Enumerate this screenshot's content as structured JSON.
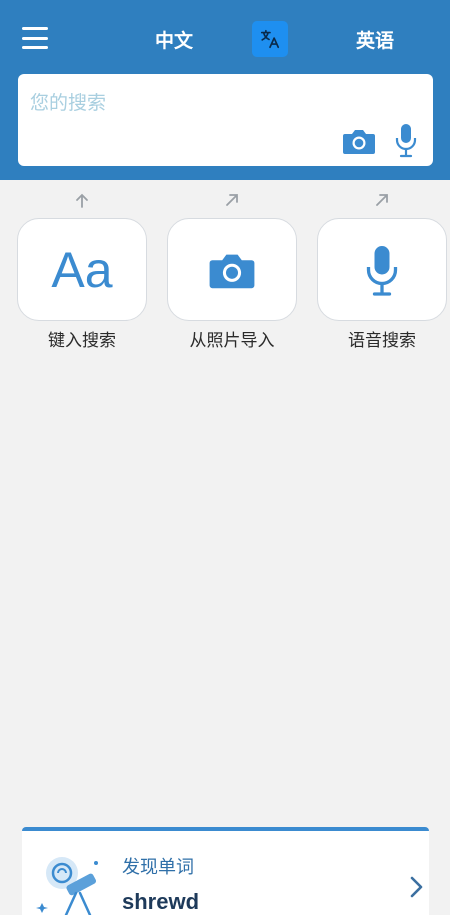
{
  "header": {
    "source_language": "中文",
    "target_language": "英语",
    "menu_icon": "hamburger-menu-icon",
    "swap_icon": "translate-icon"
  },
  "search": {
    "placeholder": "您的搜索",
    "value": "",
    "camera_icon": "camera-icon",
    "mic_icon": "microphone-icon"
  },
  "actions": [
    {
      "label": "键入搜索",
      "glyph": "Aa",
      "icon": "keyboard-text-icon"
    },
    {
      "label": "从照片导入",
      "icon": "camera-icon"
    },
    {
      "label": "语音搜索",
      "icon": "microphone-icon"
    }
  ],
  "discover": {
    "title": "发现单词",
    "word": "shrewd",
    "icon": "telescope-icon"
  },
  "colors": {
    "header_bg": "#2f7fbf",
    "accent": "#3b8bd0",
    "swap_bg": "#1e8ff0",
    "page_bg": "#f2f2f2"
  }
}
